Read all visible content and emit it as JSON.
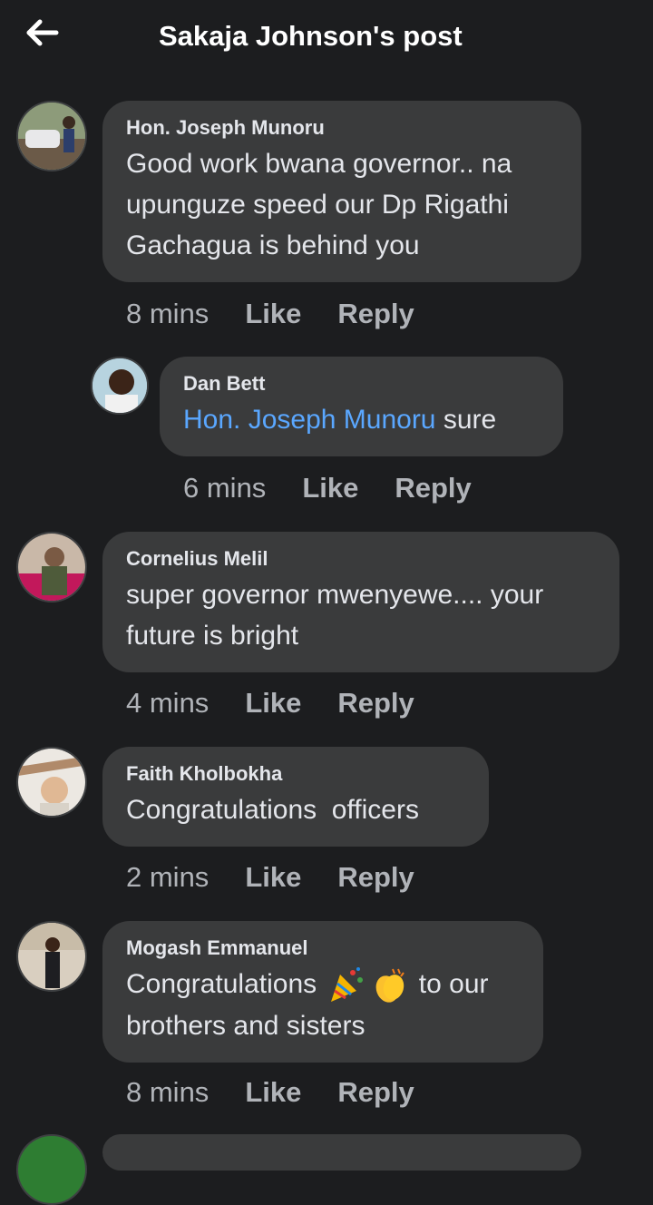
{
  "header": {
    "title": "Sakaja Johnson's post"
  },
  "comments": [
    {
      "name": "Hon. Joseph Munoru",
      "text": "Good work bwana governor.. na upunguze speed our Dp Rigathi Gachagua is behind you",
      "time": "8 mins",
      "like": "Like",
      "reply": "Reply"
    },
    {
      "name": "Dan Bett",
      "mention": "Hon. Joseph Munoru",
      "text": " sure",
      "time": "6 mins",
      "like": "Like",
      "reply": "Reply"
    },
    {
      "name": "Cornelius Melil",
      "text": "super governor mwenyewe.... your future is bright",
      "time": "4 mins",
      "like": "Like",
      "reply": "Reply"
    },
    {
      "name": "Faith Kholbokha",
      "text": "Congratulations  officers",
      "time": "2 mins",
      "like": "Like",
      "reply": "Reply"
    },
    {
      "name": "Mogash Emmanuel",
      "text_before": "Congratulations ",
      "emojis": [
        "party-popper-icon",
        "clapping-hands-icon"
      ],
      "text_after": " to our brothers and sisters",
      "time": "8 mins",
      "like": "Like",
      "reply": "Reply"
    }
  ],
  "colors": {
    "background": "#1c1d1f",
    "bubble": "#3a3b3c",
    "mention": "#5aa7ff",
    "meta": "#b0b3b8"
  }
}
